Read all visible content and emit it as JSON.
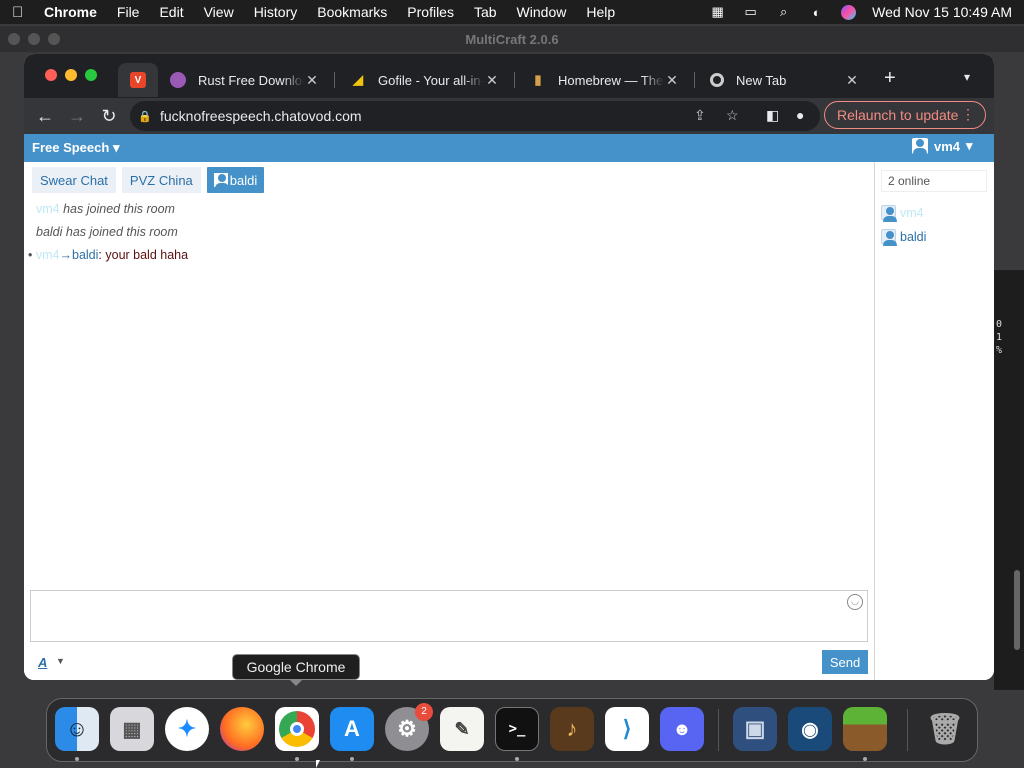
{
  "menubar": {
    "app_name": "Chrome",
    "items": [
      "File",
      "Edit",
      "View",
      "History",
      "Bookmarks",
      "Profiles",
      "Tab",
      "Window",
      "Help"
    ],
    "clock": "Wed Nov 15  10:49 AM"
  },
  "background_window": {
    "title": "MultiCraft 2.0.6",
    "terminal_lines": [
      "0",
      "1",
      "%"
    ]
  },
  "browser": {
    "tabs": [
      {
        "label": "Rust Free Download",
        "favicon": "purple-orb-icon",
        "color": "#9b59b6"
      },
      {
        "label": "Gofile - Your all-in-one",
        "favicon": "gofile-icon",
        "color": "#f1c40f"
      },
      {
        "label": "Homebrew — The Missing",
        "favicon": "homebrew-icon",
        "color": "#d4a04a"
      },
      {
        "label": "New Tab",
        "favicon": "chrome-icon",
        "color": "#cccccc"
      }
    ],
    "active_favicon_letter": "V",
    "url": "fucknofreespeech.chatovod.com",
    "relaunch_label": "Relaunch to update"
  },
  "chat": {
    "room_selector": "Free Speech",
    "current_user": "vm4",
    "room_tabs": [
      "Swear Chat",
      "PVZ China"
    ],
    "private_tab": "baldi",
    "messages": [
      {
        "user": "vm4",
        "text": "has joined this room"
      },
      {
        "user": "baldi",
        "text": "has joined this room"
      },
      {
        "bullet": "•",
        "from": "vm4",
        "arrow": "→",
        "to": "baldi",
        "text": ": your bald haha"
      }
    ],
    "online_count": "2 online",
    "online_users": [
      "vm4",
      "baldi"
    ],
    "format_label": "A",
    "send_label": "Send"
  },
  "dock": {
    "tooltip": "Google Chrome",
    "settings_badge": "2"
  },
  "colors": {
    "chat_accent": "#4591c9",
    "chrome_dark": "#202124",
    "relaunch": "#f28b82"
  }
}
